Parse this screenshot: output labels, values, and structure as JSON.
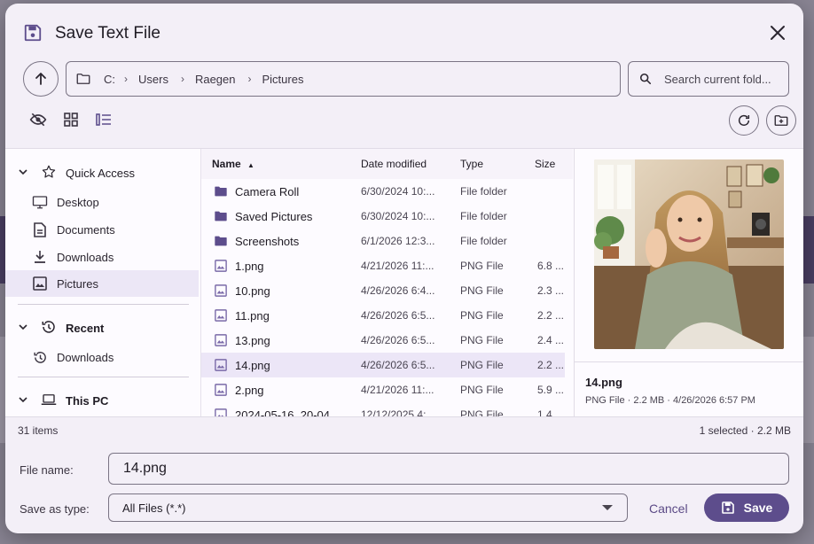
{
  "dialog": {
    "title": "Save Text File",
    "title_icon": "floppy-disk-icon",
    "close_icon": "close-icon"
  },
  "nav": {
    "up_icon": "arrow-up-icon",
    "breadcrumb": [
      "C:",
      "Users",
      "Raegen",
      "Pictures"
    ],
    "search_placeholder": "Search current fold..."
  },
  "toolbar": {
    "icons": [
      "eye-off-icon",
      "grid-view-icon",
      "list-view-icon"
    ],
    "refresh_icon": "refresh-icon",
    "new_folder_icon": "new-folder-icon"
  },
  "sidebar": {
    "quick_access": {
      "label": "Quick Access",
      "items": [
        {
          "label": "Desktop",
          "icon": "monitor-icon"
        },
        {
          "label": "Documents",
          "icon": "document-icon"
        },
        {
          "label": "Downloads",
          "icon": "download-icon"
        },
        {
          "label": "Pictures",
          "icon": "image-icon",
          "selected": true
        }
      ]
    },
    "recent": {
      "label": "Recent",
      "items": [
        {
          "label": "Downloads",
          "icon": "history-icon"
        }
      ]
    },
    "this_pc": {
      "label": "This PC"
    }
  },
  "filelist": {
    "columns": {
      "name": "Name",
      "date": "Date modified",
      "type": "Type",
      "size": "Size"
    },
    "rows": [
      {
        "name": "Camera Roll",
        "date": "6/30/2024 10:...",
        "type": "File folder",
        "size": "",
        "kind": "folder"
      },
      {
        "name": "Saved Pictures",
        "date": "6/30/2024 10:...",
        "type": "File folder",
        "size": "",
        "kind": "folder"
      },
      {
        "name": "Screenshots",
        "date": "6/1/2026 12:3...",
        "type": "File folder",
        "size": "",
        "kind": "folder"
      },
      {
        "name": "1.png",
        "date": "4/21/2026 11:...",
        "type": "PNG File",
        "size": "6.8 ...",
        "kind": "image"
      },
      {
        "name": "10.png",
        "date": "4/26/2026 6:4...",
        "type": "PNG File",
        "size": "2.3 ...",
        "kind": "image"
      },
      {
        "name": "11.png",
        "date": "4/26/2026 6:5...",
        "type": "PNG File",
        "size": "2.2 ...",
        "kind": "image"
      },
      {
        "name": "13.png",
        "date": "4/26/2026 6:5...",
        "type": "PNG File",
        "size": "2.4 ...",
        "kind": "image"
      },
      {
        "name": "14.png",
        "date": "4/26/2026 6:5...",
        "type": "PNG File",
        "size": "2.2 ...",
        "kind": "image",
        "selected": true
      },
      {
        "name": "2.png",
        "date": "4/21/2026 11:...",
        "type": "PNG File",
        "size": "5.9 ...",
        "kind": "image"
      },
      {
        "name": "2024-05-16_20-04...",
        "date": "12/12/2025 4:...",
        "type": "PNG File",
        "size": "1.4 ...",
        "kind": "image"
      }
    ]
  },
  "preview": {
    "name": "14.png",
    "meta": "PNG File  ·  2.2 MB  ·  4/26/2026 6:57 PM"
  },
  "status": {
    "count": "31 items",
    "selection": "1 selected · 2.2 MB"
  },
  "footer": {
    "filename_label": "File name:",
    "filename_value": "14.png",
    "type_label": "Save as type:",
    "type_value": "All Files (*.*)",
    "cancel_label": "Cancel",
    "save_label": "Save"
  },
  "colors": {
    "accent": "#5d4d8c",
    "selected_row": "#ece6f7",
    "dialog_bg": "#f3eff7"
  }
}
